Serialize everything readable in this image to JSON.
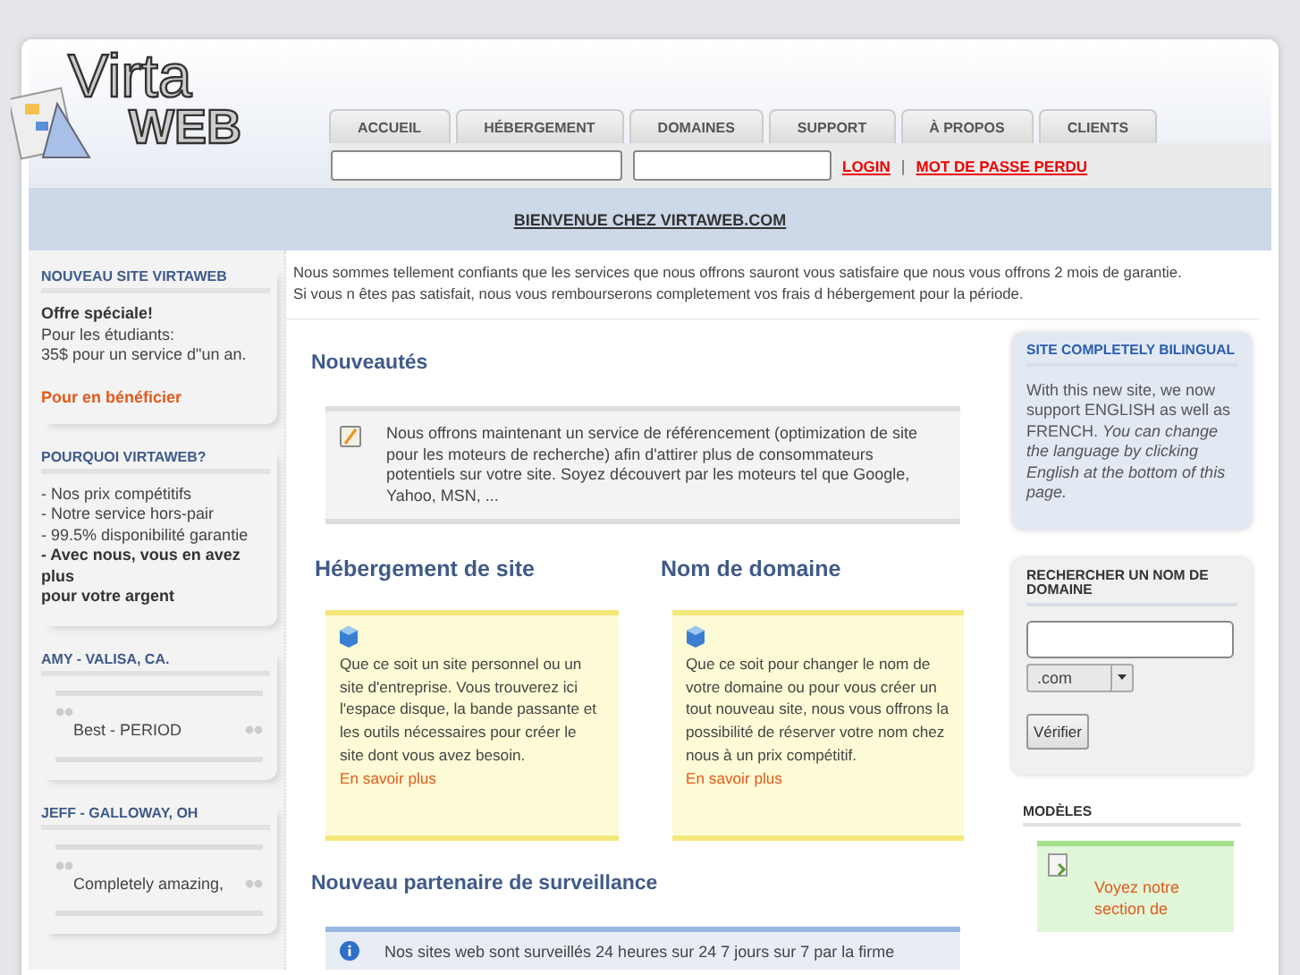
{
  "logo": {
    "line_1": "Virta",
    "line_2": "WEB"
  },
  "nav_tabs": [
    {
      "label": "ACCUEIL"
    },
    {
      "label": "HÉBERGEMENT"
    },
    {
      "label": "DOMAINES"
    },
    {
      "label": "SUPPORT"
    },
    {
      "label": "À PROPOS"
    },
    {
      "label": "CLIENTS"
    }
  ],
  "login": {
    "links": [
      "LOGIN",
      "MOT DE PASSE PERDU"
    ],
    "separator": "|"
  },
  "welcome": "BIENVENUE CHEZ VIRTAWEB.COM",
  "left_sidebar": [
    {
      "kind": "promo",
      "title": "NOUVEAU SITE VIRTAWEB",
      "lines": [
        {
          "text": "Offre spéciale!",
          "bold": true
        },
        {
          "text": "Pour les étudiants:",
          "bold": false
        },
        {
          "text": "35$ pour un service d\"un an.",
          "bold": false
        }
      ],
      "link": "Pour en bénéficier"
    },
    {
      "kind": "list",
      "title": "POURQUOI VIRTAWEB?",
      "lines": [
        {
          "text": "- Nos prix compétitifs",
          "bold": false
        },
        {
          "text": "- Notre service hors-pair",
          "bold": false
        },
        {
          "text": "- 99.5% disponibilité garantie",
          "bold": false
        },
        {
          "text": "- Avec nous, vous en avez plus",
          "bold": true
        },
        {
          "text": "pour votre argent",
          "bold": true
        }
      ]
    },
    {
      "kind": "testimonial",
      "title": "AMY - VALISA, CA.",
      "quote": "Best - PERIOD"
    },
    {
      "kind": "testimonial",
      "title": "JEFF - GALLOWAY, OH",
      "quote": "Completely amazing,"
    }
  ],
  "intro_lines": [
    "Nous sommes tellement confiants que les services que nous offrons sauront vous satisfaire que nous vous offrons 2 mois de garantie.",
    "Si vous n êtes pas satisfait, nous vous rembourserons completement vos frais d hébergement pour la période."
  ],
  "news": {
    "heading": "Nouveautés",
    "text": "Nous offrons maintenant un service de référencement (optimization de site pour les moteurs de recherche) afin d'attirer plus de consommateurs potentiels sur votre site. Soyez découvert par les moteurs tel que Google, Yahoo, MSN, ..."
  },
  "features": [
    {
      "heading": "Hébergement de site",
      "text": "Que ce soit un site personnel ou un site d'entreprise. Vous trouverez ici l'espace disque, la bande passante et les outils nécessaires pour créer le site dont vous avez besoin.",
      "link": "En savoir plus"
    },
    {
      "heading": "Nom de domaine",
      "text": "Que ce soit pour changer le nom de votre domaine ou pour vous créer un tout nouveau site, nous vous offrons la possibilité de réserver votre nom chez nous à un prix compétitif.",
      "link": "En savoir plus"
    }
  ],
  "monitoring": {
    "heading": "Nouveau partenaire de surveillance",
    "text": "Nos sites web sont surveillés 24 heures sur 24 7 jours sur 7 par la firme"
  },
  "bilingual": {
    "title": "SITE COMPLETELY BILINGUAL",
    "text": "With this new site, we now support ENGLISH as well as FRENCH. *You can change the language by clicking English at the bottom of this page.*"
  },
  "domain_search": {
    "title": "RECHERCHER UN NOM DE DOMAINE",
    "extension": ".com",
    "button": "Vérifier"
  },
  "templates": {
    "title": "MODÈLES",
    "link": "Voyez notre section de"
  }
}
